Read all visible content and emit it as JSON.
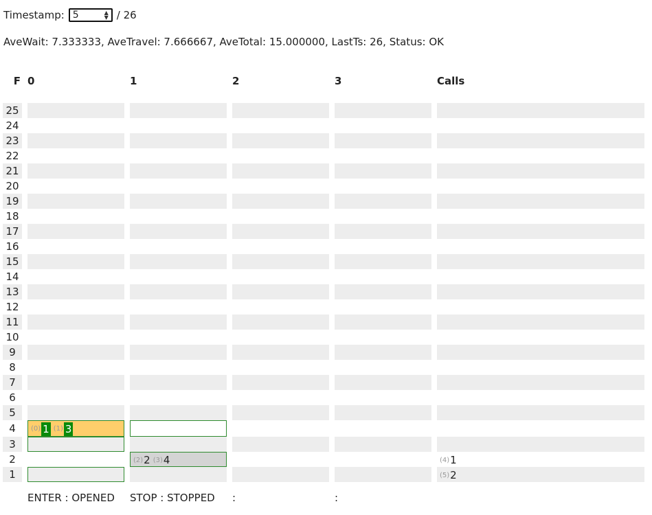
{
  "timestamp": {
    "label": "Timestamp:",
    "value": "5",
    "total": "/ 26"
  },
  "stats": "AveWait: 7.333333, AveTravel: 7.666667, AveTotal: 15.000000, LastTs: 26, Status: OK",
  "headers": {
    "floor": "F",
    "elevators": [
      "0",
      "1",
      "2",
      "3"
    ],
    "calls": "Calls"
  },
  "floors": [
    "25",
    "24",
    "23",
    "22",
    "21",
    "20",
    "19",
    "18",
    "17",
    "16",
    "15",
    "14",
    "13",
    "12",
    "11",
    "10",
    "9",
    "8",
    "7",
    "6",
    "5",
    "4",
    "3",
    "2",
    "1"
  ],
  "elevators": [
    {
      "id": "0",
      "floor": "4",
      "state": "OPENED",
      "cars": {
        "4": "open",
        "3": "box",
        "1": "box"
      },
      "passengers": [
        {
          "id": "(0)",
          "dest": "1"
        },
        {
          "id": "(1)",
          "dest": "3"
        }
      ]
    },
    {
      "id": "1",
      "floor": "2",
      "state": "STOPPED",
      "cars": {
        "4": "box",
        "2": "stop"
      },
      "passengers": [
        {
          "id": "(2)",
          "dest": "2"
        },
        {
          "id": "(3)",
          "dest": "4"
        }
      ]
    },
    {
      "id": "2",
      "floor": "",
      "state": "",
      "cars": {},
      "passengers": []
    },
    {
      "id": "3",
      "floor": "",
      "state": "",
      "cars": {},
      "passengers": []
    }
  ],
  "calls": {
    "2": [
      {
        "id": "(4)",
        "dest": "1"
      }
    ],
    "1": [
      {
        "id": "(5)",
        "dest": "2"
      }
    ]
  },
  "legend": [
    "ENTER : OPENED",
    "STOP : STOPPED",
    ":",
    ":"
  ],
  "colors": {
    "open": "#ffce6b",
    "stop": "#d4d4d4",
    "border": "#2e8b2e",
    "passenger_highlight": "#0a8a0a",
    "stripe": "#ededed"
  }
}
